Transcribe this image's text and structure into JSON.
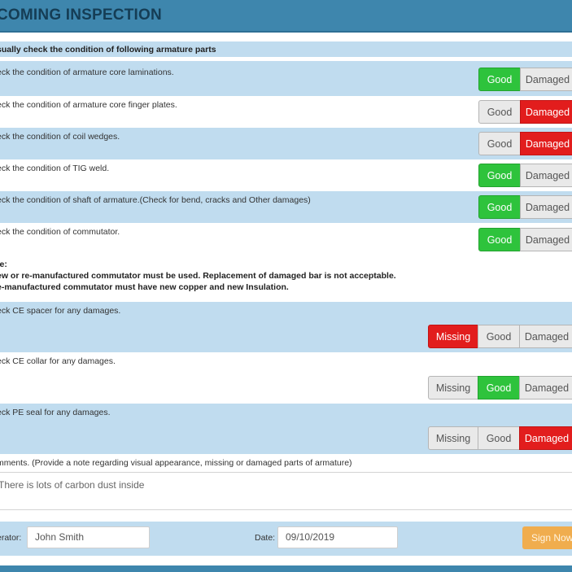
{
  "header": {
    "title": "COMING INSPECTION"
  },
  "section_title": "sually check the condition of following armature parts",
  "options": {
    "good": "Good",
    "damaged": "Damaged",
    "missing": "Missing"
  },
  "items": [
    {
      "label": "eck the condition of armature core laminations.",
      "state": "Good"
    },
    {
      "label": "eck the condition of armature core finger plates.",
      "state": "Damaged"
    },
    {
      "label": "eck the condition of coil wedges.",
      "state": "Damaged"
    },
    {
      "label": "eck the condition of TIG weld.",
      "state": "Good"
    },
    {
      "label": "eck the condition of shaft of armature.(Check for bend, cracks and Other damages)",
      "state": "Good"
    },
    {
      "label": "eck the condition of commutator.",
      "state": "Good"
    }
  ],
  "note": {
    "heading": "te:",
    "line1": "ew or re-manufactured commutator must be used. Replacement of damaged bar is not acceptable.",
    "line2": "e-manufactured commutator must have new copper and new Insulation."
  },
  "items2": [
    {
      "label": "eck CE spacer for any damages.",
      "state": "Missing"
    },
    {
      "label": "eck CE collar for any damages.",
      "state": "Good"
    },
    {
      "label": "eck PE seal for any damages.",
      "state": "Damaged"
    }
  ],
  "comments": {
    "label": "mments. (Provide a note regarding visual appearance, missing or damaged parts of armature)",
    "value": "There is lots of carbon dust inside"
  },
  "footer": {
    "operator_label": "erator:",
    "operator_value": "John Smith",
    "date_label": "Date:",
    "date_value": "09/10/2019",
    "sign_button": "Sign Now"
  },
  "colors": {
    "header": "#3e86ad",
    "row_blue": "#c0dcef",
    "good_active": "#2ec33c",
    "damaged_active": "#e21d1d",
    "sign_button": "#f0ad4e"
  }
}
